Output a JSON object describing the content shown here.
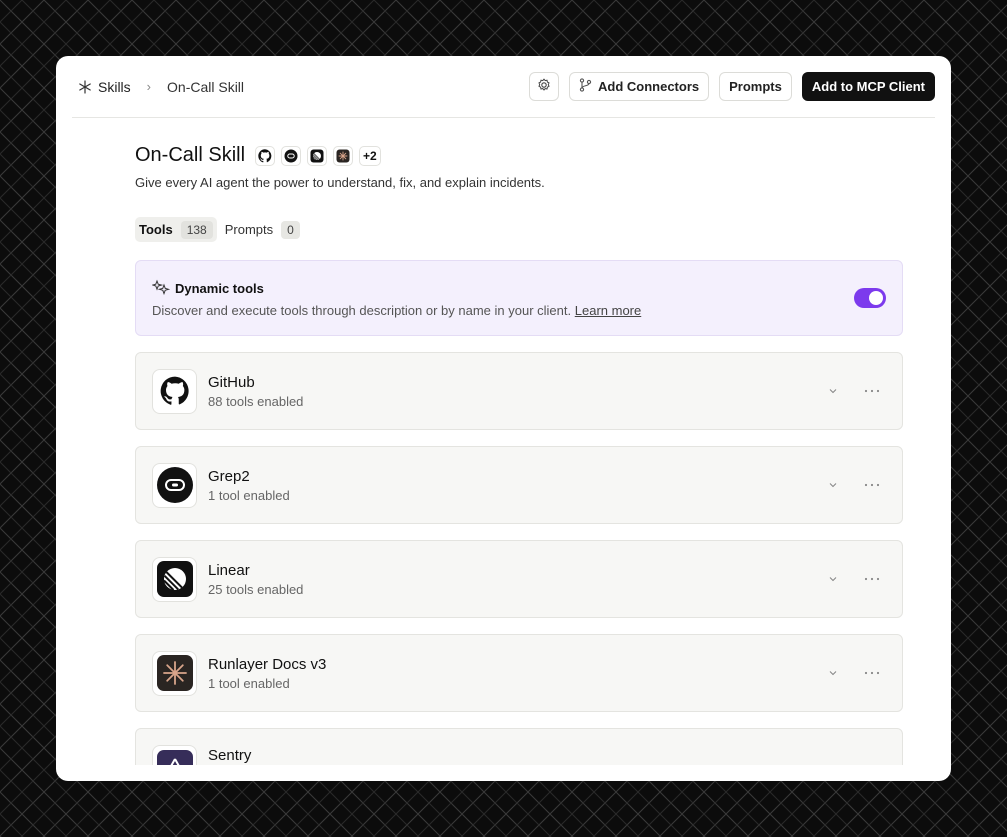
{
  "breadcrumb": {
    "root": "Skills",
    "current": "On-Call Skill"
  },
  "header": {
    "add_connectors_label": "Add Connectors",
    "prompts_label": "Prompts",
    "add_mcp_label": "Add to MCP Client"
  },
  "skill": {
    "title": "On-Call Skill",
    "extra_count": "+2",
    "description": "Give every AI agent the power to understand, fix, and explain incidents."
  },
  "tabs": [
    {
      "label": "Tools",
      "count": "138"
    },
    {
      "label": "Prompts",
      "count": "0"
    }
  ],
  "dynamic": {
    "title": "Dynamic tools",
    "description": "Discover and execute tools through description or by name in your client.",
    "link": "Learn more",
    "enabled": true
  },
  "connectors": [
    {
      "name": "GitHub",
      "status": "88 tools enabled",
      "icon": "github-icon"
    },
    {
      "name": "Grep2",
      "status": "1 tool enabled",
      "icon": "grep2-icon"
    },
    {
      "name": "Linear",
      "status": "25 tools enabled",
      "icon": "linear-icon"
    },
    {
      "name": "Runlayer Docs v3",
      "status": "1 tool enabled",
      "icon": "runlayer-icon"
    },
    {
      "name": "Sentry",
      "status": "",
      "icon": "sentry-icon"
    }
  ],
  "colors": {
    "accent": "#7c3aed",
    "dynamic_bg": "#f4f0fd",
    "primary_button": "#111111"
  }
}
